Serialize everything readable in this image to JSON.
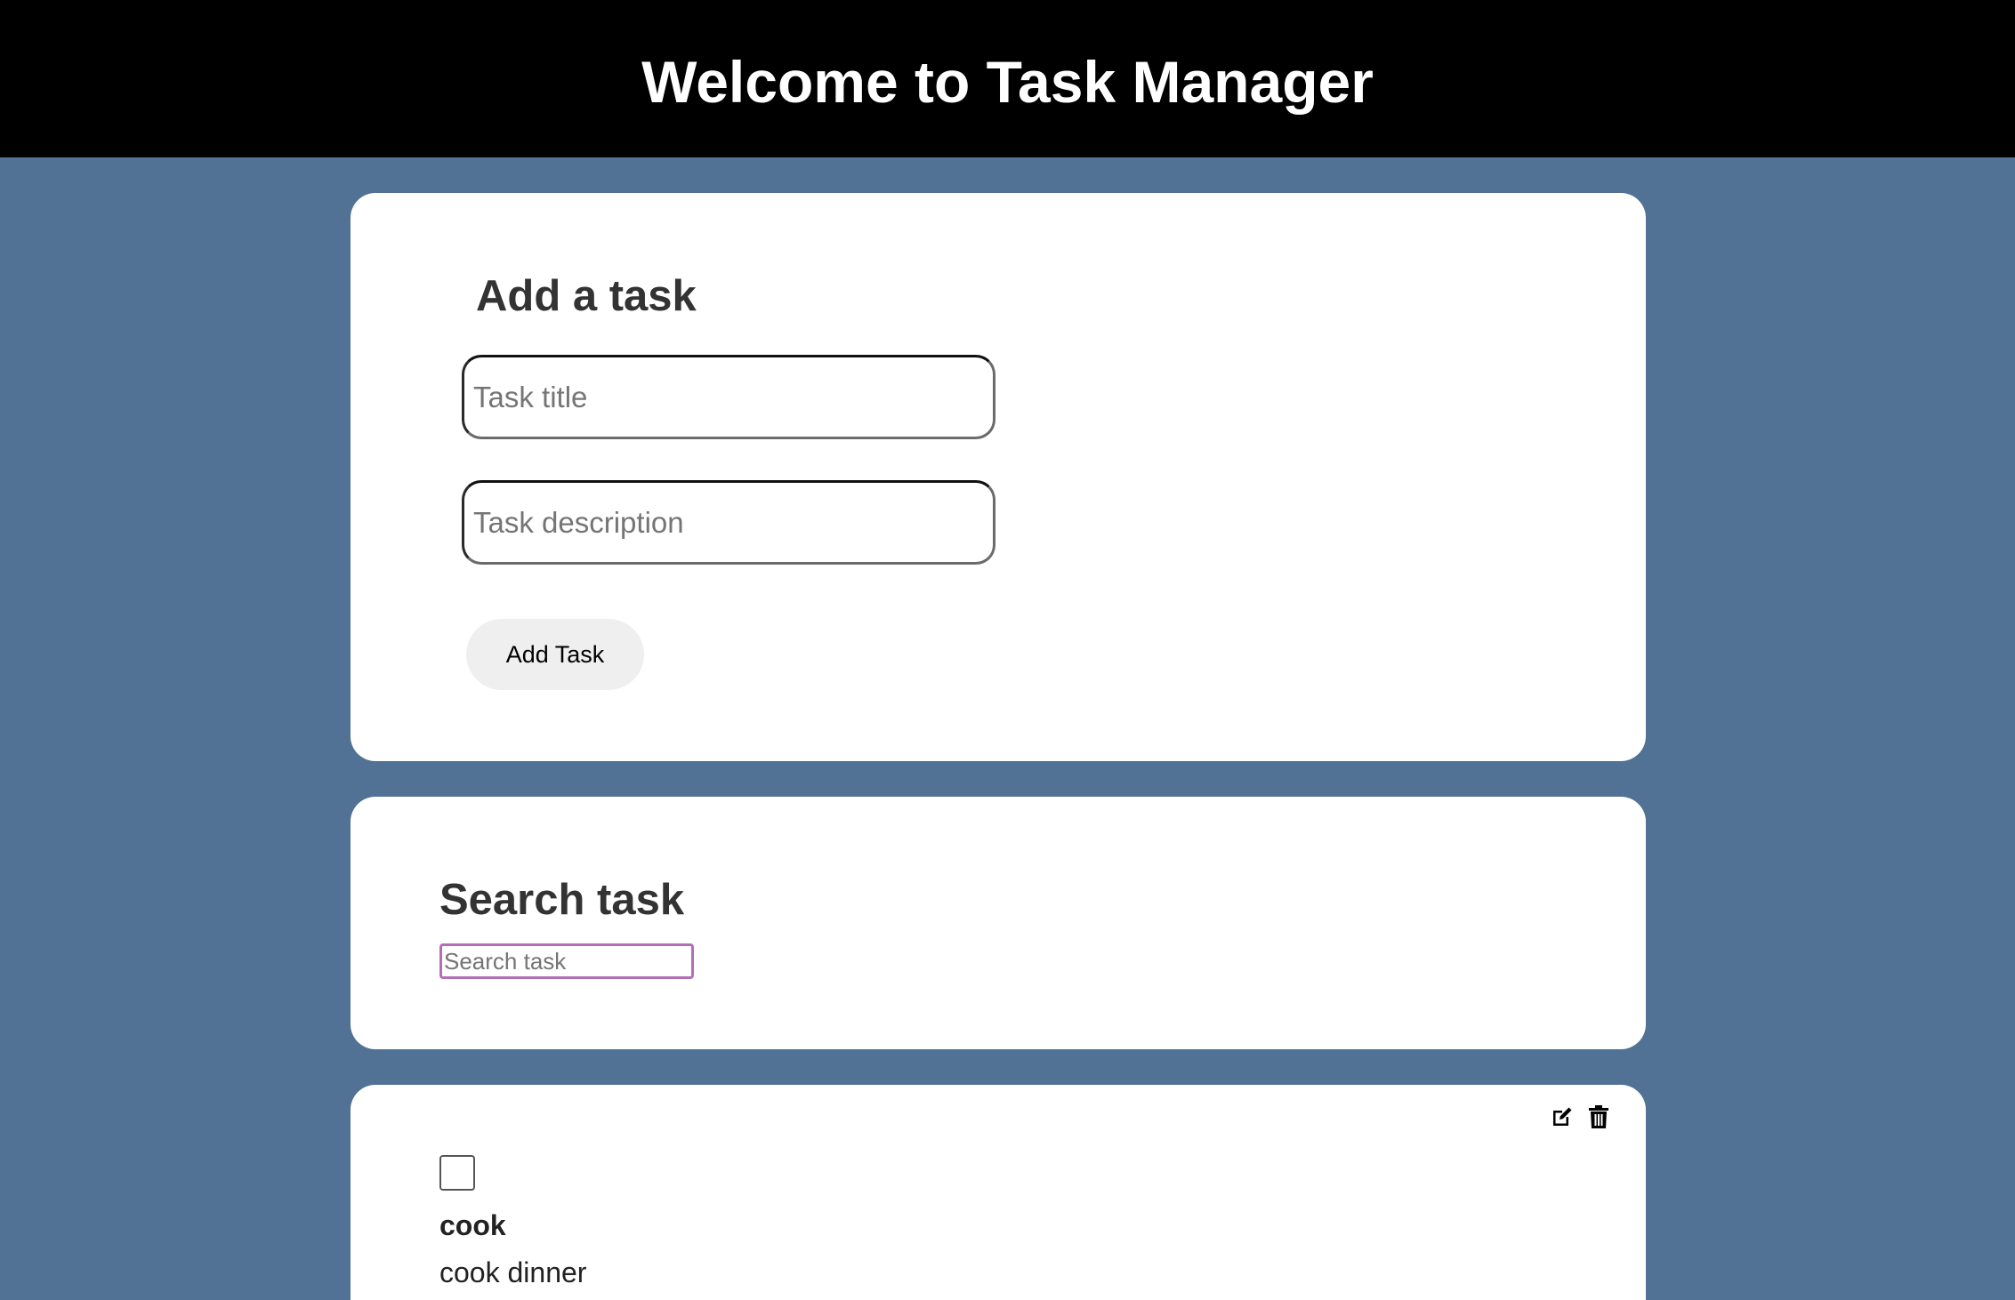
{
  "header": {
    "title": "Welcome to Task Manager"
  },
  "add_task": {
    "heading": "Add a task",
    "title_placeholder": "Task title",
    "title_value": "",
    "description_placeholder": "Task description",
    "description_value": "",
    "button_label": "Add Task"
  },
  "search": {
    "heading": "Search task",
    "placeholder": "Search task",
    "value": ""
  },
  "tasks": [
    {
      "title": "cook",
      "description": "cook dinner",
      "completed": false,
      "actions": [
        "edit-icon",
        "trash-icon"
      ]
    }
  ],
  "colors": {
    "page_background": "#517294",
    "header_background": "#000000",
    "header_text": "#ffffff",
    "card_background": "#ffffff",
    "button_background": "#efefef",
    "search_border": "#b36fb6"
  }
}
